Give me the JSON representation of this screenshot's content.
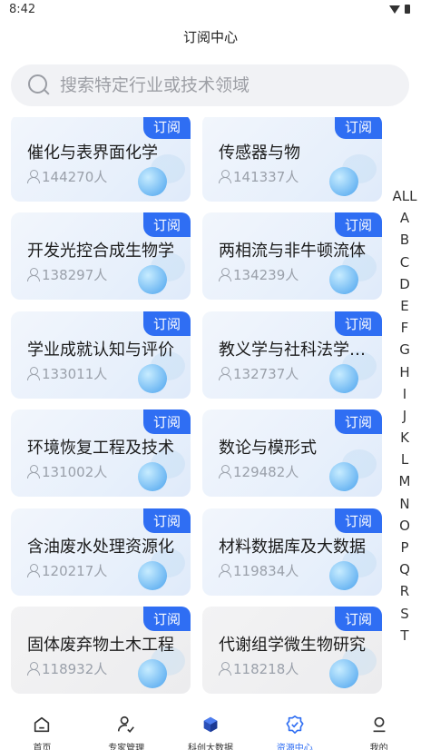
{
  "status": {
    "time": "8:42"
  },
  "header": {
    "title": "订阅中心"
  },
  "search": {
    "placeholder": "搜索特定行业或技术领域"
  },
  "subscribe_label": "订阅",
  "cards": [
    {
      "title": "",
      "count": ""
    },
    {
      "title": "",
      "count": ""
    },
    {
      "title": "催化与表界面化学",
      "count": "144270人"
    },
    {
      "title": "传感器与物",
      "count": "141337人"
    },
    {
      "title": "开发光控合成生物学",
      "count": "138297人"
    },
    {
      "title": "两相流与非牛顿流体",
      "count": "134239人"
    },
    {
      "title": "学业成就认知与评价",
      "count": "133011人"
    },
    {
      "title": "教义学与社科法学研究",
      "count": "132737人"
    },
    {
      "title": "环境恢复工程及技术",
      "count": "131002人"
    },
    {
      "title": "数论与模形式",
      "count": "129482人"
    },
    {
      "title": "含油废水处理资源化",
      "count": "120217人"
    },
    {
      "title": "材料数据库及大数据",
      "count": "119834人"
    },
    {
      "title": "固体废弃物土木工程",
      "count": "118932人"
    },
    {
      "title": "代谢组学微生物研究",
      "count": "118218人"
    }
  ],
  "alphabet": [
    "ALL",
    "A",
    "B",
    "C",
    "D",
    "E",
    "F",
    "G",
    "H",
    "I",
    "J",
    "K",
    "L",
    "M",
    "N",
    "O",
    "P",
    "Q",
    "R",
    "S",
    "T"
  ],
  "tabbar": [
    {
      "label": "首页",
      "icon": "home-icon"
    },
    {
      "label": "专家管理",
      "icon": "expert-icon"
    },
    {
      "label": "科创大数据",
      "icon": "big-data-icon"
    },
    {
      "label": "资源中心",
      "icon": "resource-center-icon",
      "active": true
    },
    {
      "label": "我的",
      "icon": "profile-icon"
    }
  ],
  "colors": {
    "accent": "#2f6ef3",
    "badge": "#2f6ef3",
    "search_bg": "#f1f2f5"
  }
}
